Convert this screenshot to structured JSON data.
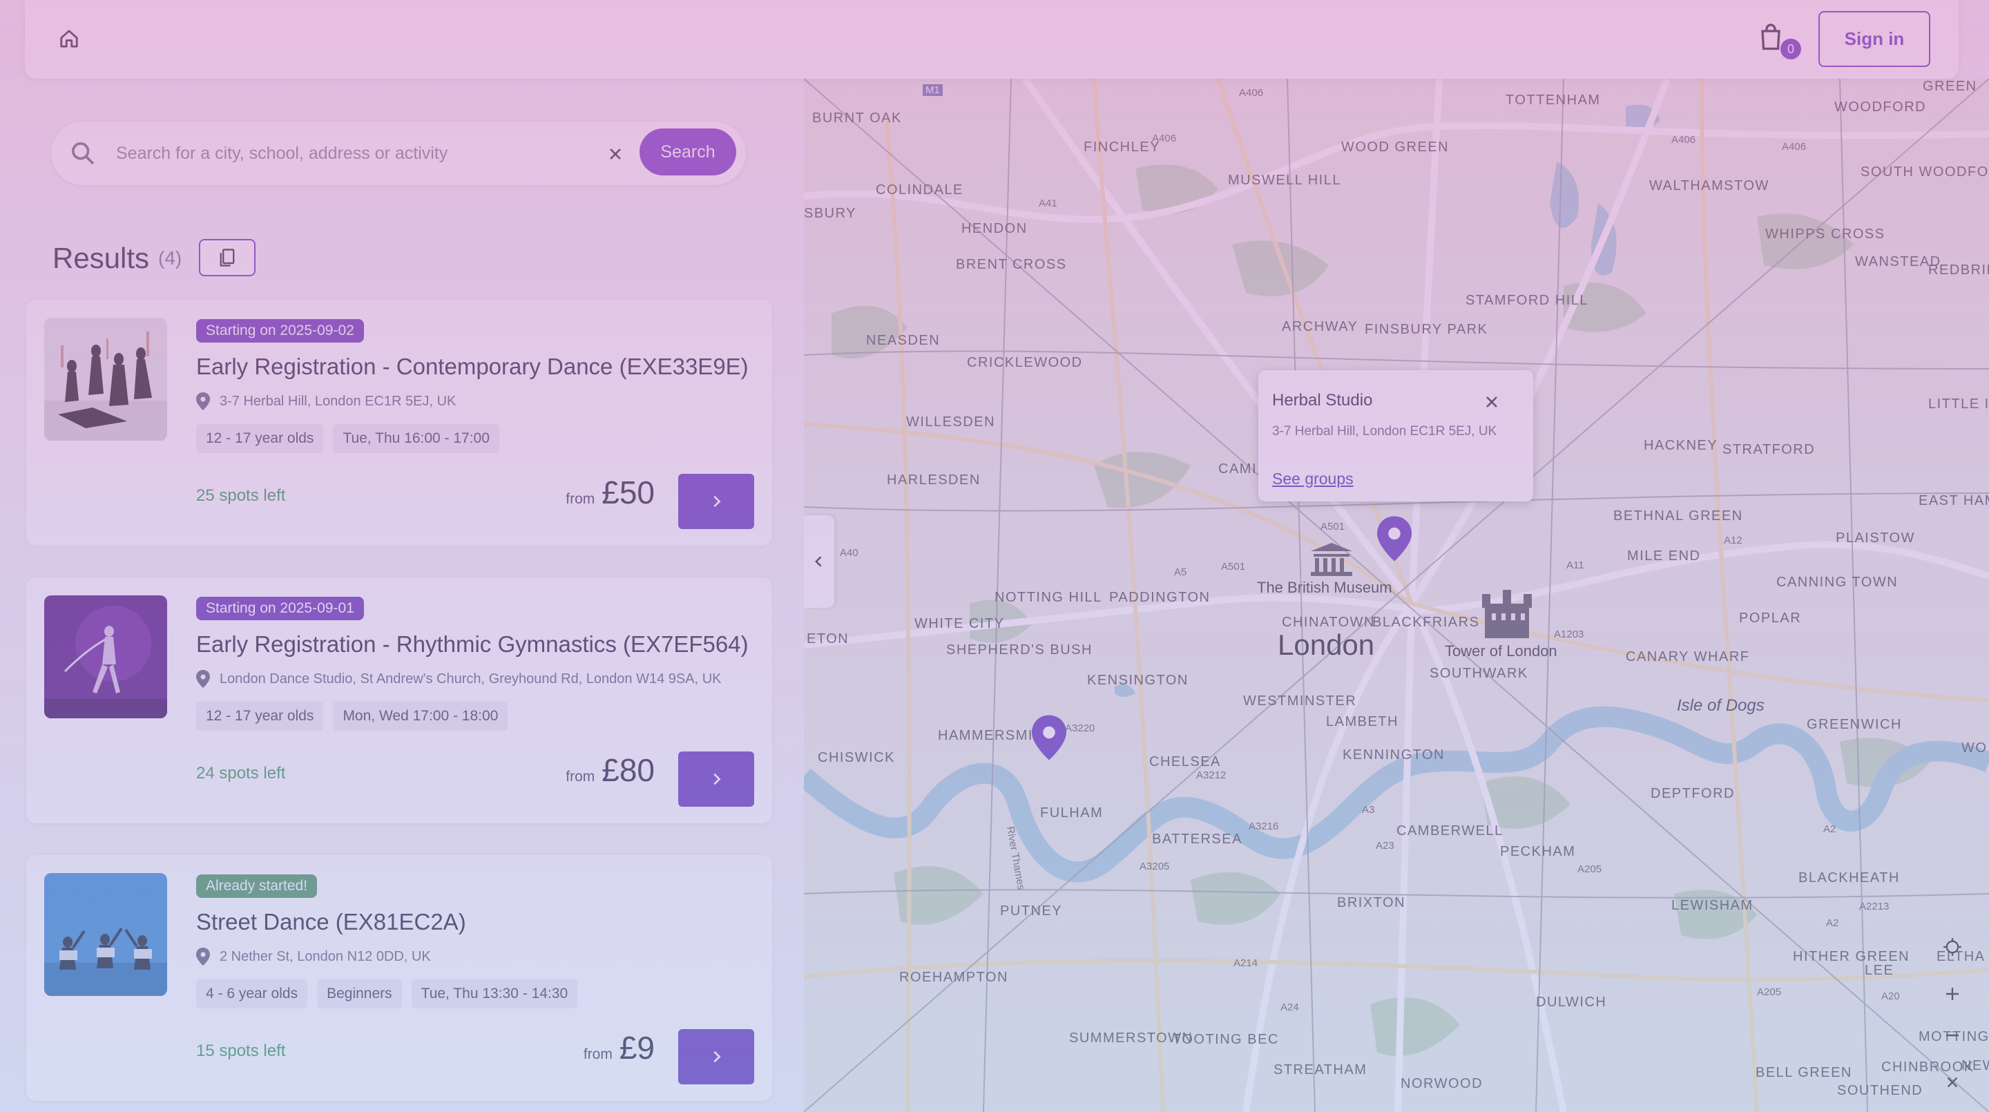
{
  "header": {
    "home_icon": "home-icon",
    "cart_icon": "shopping-bag-icon",
    "cart_count": "0",
    "signin_label": "Sign in"
  },
  "search": {
    "placeholder": "Search for a city, school, address or activity",
    "value": "",
    "button_label": "Search"
  },
  "results": {
    "title": "Results",
    "count": "(4)",
    "cards": [
      {
        "badge": "Starting on 2025-09-02",
        "badge_color": "#6f39b8",
        "title": "Early Registration - Contemporary Dance (EXE33E9E)",
        "address": "3-7 Herbal Hill, London EC1R 5EJ, UK",
        "tags": [
          "12 - 17 year olds",
          "Tue, Thu 16:00 - 17:00"
        ],
        "spots": "25 spots left",
        "price_from": "from",
        "price": "£50"
      },
      {
        "badge": "Starting on 2025-09-01",
        "badge_color": "#6f39b8",
        "title": "Early Registration - Rhythmic Gymnastics (EX7EF564)",
        "address": "London Dance Studio, St Andrew's Church, Greyhound Rd, London W14 9SA, UK",
        "tags": [
          "12 - 17 year olds",
          "Mon, Wed 17:00 - 18:00"
        ],
        "spots": "24 spots left",
        "price_from": "from",
        "price": "£80"
      },
      {
        "badge": "Already started!",
        "badge_color": "#4f9a63",
        "title": "Street Dance (EX81EC2A)",
        "address": "2 Nether St, London N12 0DD, UK",
        "tags": [
          "4 - 6 year olds",
          "Beginners",
          "Tue, Thu 13:30 - 14:30"
        ],
        "spots": "15 spots left",
        "price_from": "from",
        "price": "£9"
      }
    ]
  },
  "map": {
    "popup": {
      "title": "Herbal Studio",
      "address": "3-7 Herbal Hill, London EC1R 5EJ, UK",
      "link": "See groups"
    },
    "city_label": "London",
    "pois": [
      "The British Museum",
      "Tower of London"
    ],
    "areas": [
      "TOTTENHAM",
      "WOODFORD",
      "FINCHLEY",
      "WOOD GREEN",
      "WALTHAMSTOW",
      "SOUTH WOODFORD",
      "BURNT OAK",
      "COLINDALE",
      "MUSWELL HILL",
      "HENDON",
      "WHIPPS CROSS",
      "WANSTEAD",
      "BRENT CROSS",
      "REDBRIDGE",
      "STAMFORD HILL",
      "ARCHWAY",
      "FINSBURY PARK",
      "NEASDEN",
      "CRICKLEWOOD",
      "LITTLE ILF",
      "HACKNEY",
      "STRATFORD",
      "WILLESDEN",
      "HARLESDEN",
      "CAMI",
      "BETHNAL GREEN",
      "EAST HAM",
      "MILE END",
      "PLAISTOW",
      "CANNING TOWN",
      "NOTTING HILL",
      "PADDINGTON",
      "WHITE CITY",
      "SHEPHERD'S BUSH",
      "CHINATOWN",
      "BLACKFRIARS",
      "POPLAR",
      "CANARY WHARF",
      "SOUTHWARK",
      "KENSINGTON",
      "WESTMINSTER",
      "HAMMERSMI",
      "LAMBETH",
      "GREENWICH",
      "CHISWICK",
      "CHELSEA",
      "KENNINGTON",
      "DEPTFORD",
      "FULHAM",
      "BATTERSEA",
      "CAMBERWELL",
      "PECKHAM",
      "BLACKHEATH",
      "PUTNEY",
      "BRIXTON",
      "LEWISHAM",
      "ROEHAMPTON",
      "HITHER GREEN",
      "LEE",
      "DULWICH",
      "MOTTING",
      "SUMMERSTOWN",
      "TOOTING BEC",
      "STREATHAM",
      "NORWOOD",
      "BELL GREEN",
      "CHINBROOK",
      "SOUTHEND",
      "SBURY",
      "ETON",
      "GREEN",
      "ELTHA",
      "WO",
      "NEW"
    ],
    "isle_label": "Isle of Dogs",
    "river_label": "River Thames",
    "roads": [
      "M1",
      "A406",
      "A406",
      "A41",
      "A501",
      "A501",
      "A5",
      "A11",
      "A12",
      "A1203",
      "A40",
      "A3220",
      "A3212",
      "A3216",
      "A3205",
      "A3",
      "A23",
      "A205",
      "A214",
      "A24",
      "A2",
      "A2",
      "A205",
      "A20",
      "A2213",
      "A406",
      "A406"
    ],
    "pin_color": "#6a3cc0",
    "controls": [
      "locate-icon",
      "zoom-in-icon",
      "zoom-out-icon",
      "close-icon"
    ]
  },
  "colors": {
    "accent": "#6a3cc0",
    "spots": "#3e9b5a",
    "map_land": "#e9efe9",
    "map_water": "#aad3df",
    "map_park": "#c8dfc4"
  }
}
